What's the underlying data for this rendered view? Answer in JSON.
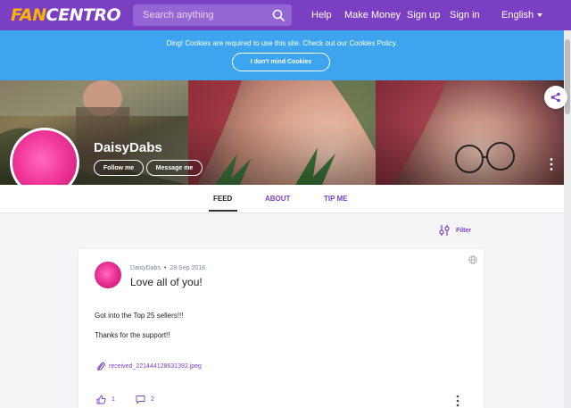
{
  "header": {
    "logo_part1": "FAN",
    "logo_part2": "CENTRO",
    "search_placeholder": "Search anything",
    "nav": {
      "help": "Help",
      "make_money": "Make Money",
      "sign_up": "Sign up",
      "sign_in": "Sign in",
      "language": "English"
    }
  },
  "cookie_bar": {
    "text": "Ding! Cookies are required to use this site. Check out our Cookies Policy.",
    "button": "I don't mind Cookies"
  },
  "profile": {
    "name": "DaisyDabs",
    "follow_button": "Follow me",
    "message_button": "Message me"
  },
  "tabs": [
    {
      "label": "FEED"
    },
    {
      "label": "ABOUT"
    },
    {
      "label": "TIP ME"
    }
  ],
  "filter_label": "Filter",
  "post": {
    "author": "DaisyDabs",
    "date": "28 Sep 2018",
    "title": "Love all of you!",
    "body_line1": "Got into the Top 25 sellers!!!",
    "body_line2": "Thanks for the support!!",
    "attachment": "received_221444128631392.jpeg",
    "likes": "1",
    "comments": "2"
  },
  "colors": {
    "brand": "#7b3fc4",
    "cookie_bar": "#3da5ef",
    "logo_accent": "#ffb400"
  }
}
